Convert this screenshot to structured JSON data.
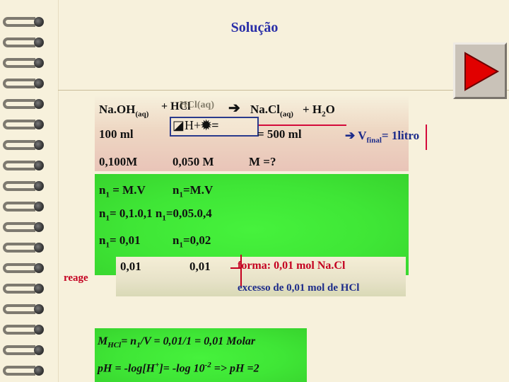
{
  "title": "Solução",
  "equation": {
    "naoh": "Na.OH",
    "naoh_sub": "(aq)",
    "plus_hcl": "+ HCl",
    "garble": "HCl(aq)",
    "arrow_icon": "arrow-right",
    "nacl": "Na.Cl",
    "nacl_sub": "(aq)",
    "plus_water": "+ H",
    "water_sub": "2",
    "water_end": "O"
  },
  "overlay": {
    "symbol_label": "H+",
    "eq_sign": "="
  },
  "volumes": {
    "v1": "100 ml",
    "v2": "= 500 ml",
    "vfinal_prefix": "V",
    "vfinal_sub": "final",
    "vfinal_value": "= 1litro"
  },
  "molarities": {
    "m1": "0,100M",
    "m2": "0,050 M",
    "m3": "M =?"
  },
  "calc": {
    "r1_a_prefix": "n",
    "r1_a_sub": "1",
    "r1_a_rest": " = M.V",
    "r1_b_prefix": "n",
    "r1_b_sub": "1",
    "r1_b_rest": "=M.V",
    "r2_a_prefix": "n",
    "r2_a_sub": "1",
    "r2_a_rest": "= 0,1.0,1",
    "r2_b_prefix": "n",
    "r2_b_sub": "1",
    "r2_b_rest": "=0,05.0,4",
    "r3_a_prefix": "n",
    "r3_a_sub": "1",
    "r3_a_rest": "= 0,01",
    "r3_b_prefix": "n",
    "r3_b_sub": "1",
    "r3_b_rest": "=0,02"
  },
  "reage": {
    "label": "reage",
    "v1": "0,01",
    "v2": "0,01",
    "forma": "forma: 0,01 mol Na.Cl",
    "excesso": "excesso de 0,01 mol de HCl"
  },
  "result": {
    "m_prefix": "M",
    "m_sub": "HCl",
    "m_eq1": "= n",
    "m_eq1_sub": "1",
    "m_rest": "/V = 0,01/1 = 0,01 Molar",
    "ph_a": "pH = -log[H",
    "ph_sup1": "+",
    "ph_b": "]= -log 10",
    "ph_sup2": "-2",
    "ph_c": " => pH =2"
  },
  "colors": {
    "title": "#2a2fa8",
    "green": "#3fe636",
    "red": "#c40020"
  }
}
